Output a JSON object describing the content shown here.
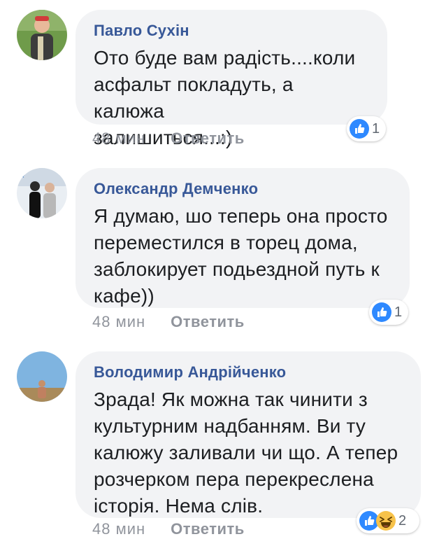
{
  "comments": [
    {
      "author": "Павло Сухін",
      "text_lines": [
        "Ото буде вам радість....коли",
        "асфальт покладуть, а калюжа",
        "залишиться...:)"
      ],
      "time": "48 мин",
      "reply_label": "Ответить",
      "reaction_count": "1",
      "reactions": [
        "like-icon"
      ]
    },
    {
      "author": "Олександр Демченко",
      "text_lines": [
        "Я думаю, шо теперь она просто",
        "переместился в торец дома,",
        "заблокирует подьездной путь к",
        "кафе))"
      ],
      "time": "48 мин",
      "reply_label": "Ответить",
      "reaction_count": "1",
      "reactions": [
        "like-icon"
      ]
    },
    {
      "author": "Володимир Андрійченко",
      "text_lines": [
        "Зрада! Як можна так чинити з",
        "культурним надбанням. Ви ту",
        "калюжу заливали чи що. А тепер",
        "розчерком пера перекреслена",
        "історія. Нема слів."
      ],
      "time": "48 мин",
      "reply_label": "Ответить",
      "reaction_count": "2",
      "reactions": [
        "like-icon",
        "haha-icon"
      ]
    }
  ],
  "colors": {
    "author": "#385898",
    "bubble": "#f2f3f5",
    "meta": "#90949c",
    "like": "#2e89ff",
    "haha": "#f7c24a"
  }
}
